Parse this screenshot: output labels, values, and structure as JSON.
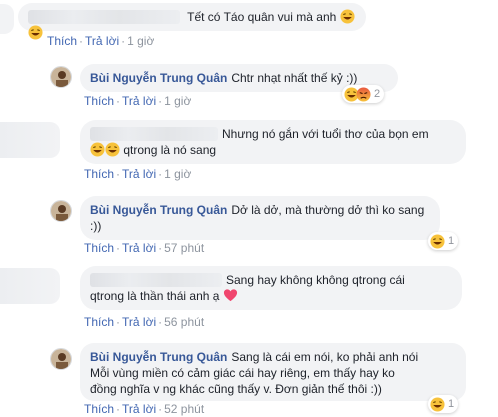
{
  "comments": [
    {
      "text": "Tết có Táo quân vui mà anh",
      "like": "Thích",
      "reply": "Trả lời",
      "time": "1 giờ"
    },
    {
      "author": "Bùi Nguyễn Trung Quân",
      "text": "Chtr nhạt nhất thế kỷ :))",
      "like": "Thích",
      "reply": "Trả lời",
      "time": "1 giờ",
      "reaction_count": "2"
    },
    {
      "text_line1": "Nhưng nó gắn với tuổi thơ của bọn em",
      "text_line2": "qtrong là nó sang",
      "like": "Thích",
      "reply": "Trả lời",
      "time": "1 giờ"
    },
    {
      "author": "Bùi Nguyễn Trung Quân",
      "text_line1": "Dở là dở, mà thường dở thì ko sang",
      "text_line2": ":))",
      "like": "Thích",
      "reply": "Trả lời",
      "time": "57 phút",
      "reaction_count": "1"
    },
    {
      "text_line1": "Sang hay không không qtrong cái",
      "text_line2": "qtrong là thần thái anh ạ",
      "like": "Thích",
      "reply": "Trả lời",
      "time": "56 phút"
    },
    {
      "author": "Bùi Nguyễn Trung Quân",
      "text_line1": "Sang là cái em nói, ko phải anh nói",
      "text_line2": "Mỗi vùng miền có cảm giác cái hay riêng, em thấy hay ko",
      "text_line3": "đồng nghĩa v ng khác cũng thấy v. Đơn giản thế thôi :))",
      "like": "Thích",
      "reply": "Trả lời",
      "time": "52 phút",
      "reaction_count": "1"
    }
  ],
  "meta_separator": "·",
  "colors": {
    "link": "#4267b2",
    "author": "#385898",
    "bubble": "#f2f3f5",
    "meta": "#8d949e"
  }
}
